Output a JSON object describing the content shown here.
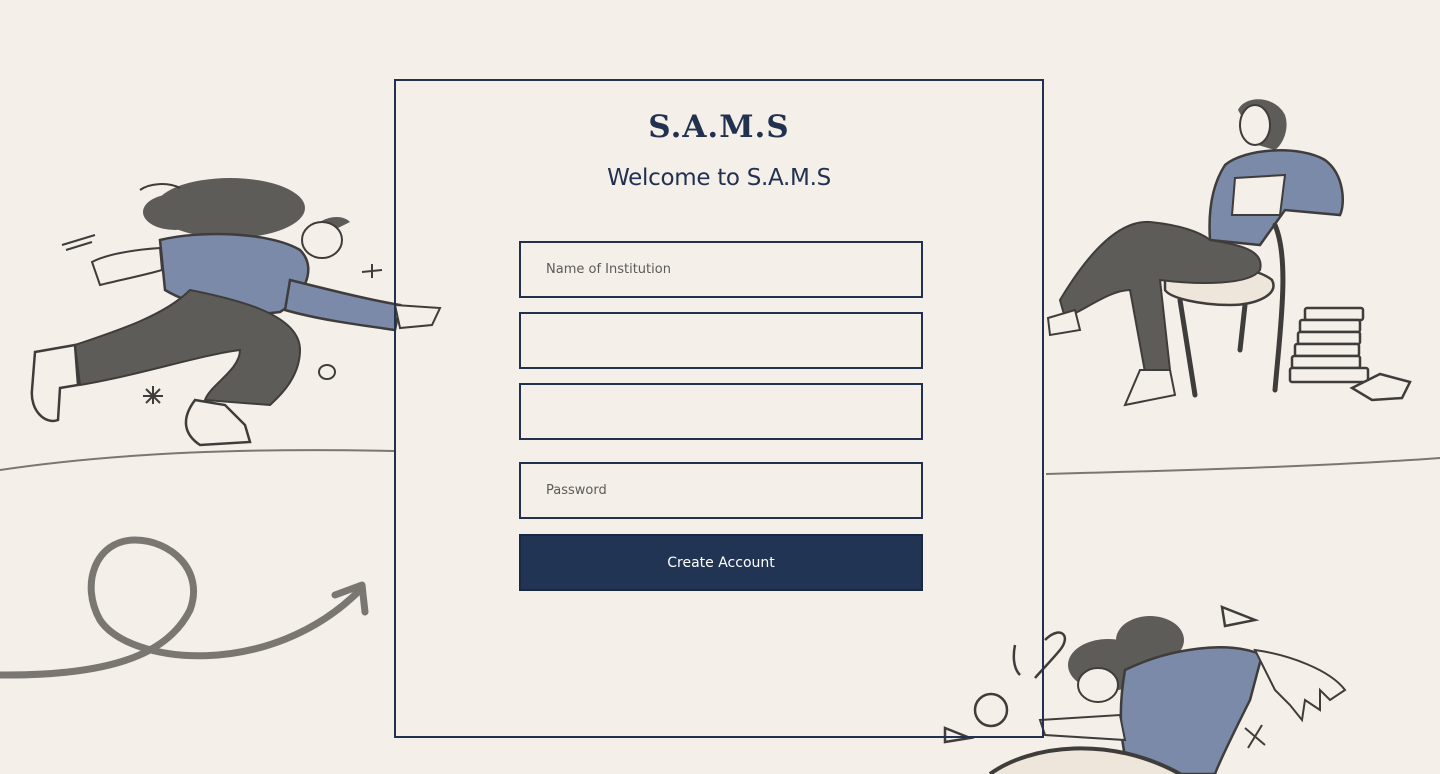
{
  "app": {
    "brand": "S.A.M.S",
    "welcome": "Welcome to S.A.M.S"
  },
  "form": {
    "institution_placeholder": "Name of Institution",
    "field2_placeholder": "",
    "field3_placeholder": "",
    "password_placeholder": "Password",
    "submit_label": "Create Account"
  },
  "colors": {
    "background": "#f5efe9",
    "primary": "#223454",
    "illustration_gray": "#5e5c59",
    "illustration_blue": "#7a8aa8"
  }
}
